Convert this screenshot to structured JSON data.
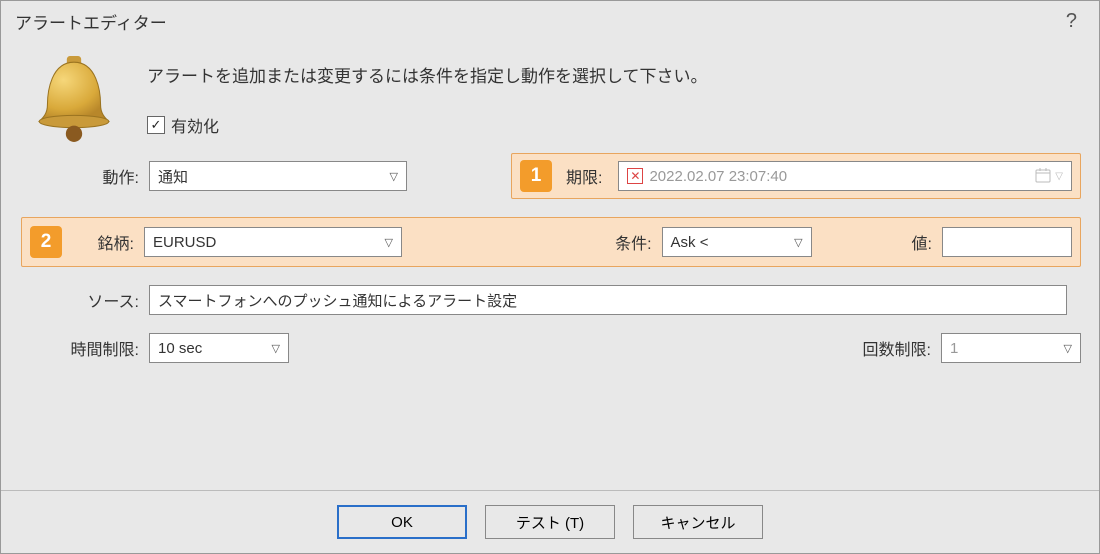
{
  "window": {
    "title": "アラートエディター",
    "help_char": "?"
  },
  "instruction": "アラートを追加または変更するには条件を指定し動作を選択して下さい。",
  "checkbox": {
    "label": "有効化",
    "checked": "✓"
  },
  "labels": {
    "action": "動作:",
    "expiration": "期限:",
    "symbol": "銘柄:",
    "condition": "条件:",
    "value": "値:",
    "source": "ソース:",
    "time_limit": "時間制限:",
    "count_limit": "回数制限:"
  },
  "fields": {
    "action": "通知",
    "expiration": "2022.02.07 23:07:40",
    "symbol": "EURUSD",
    "condition": "Ask <",
    "value": "",
    "source": "スマートフォンへのプッシュ通知によるアラート設定",
    "time_limit": "10 sec",
    "count_limit": "1"
  },
  "badges": {
    "one": "1",
    "two": "2"
  },
  "buttons": {
    "ok": "OK",
    "test": "テスト (T)",
    "cancel": "キャンセル"
  },
  "icons": {
    "x": "✕",
    "calendar": "🗓"
  }
}
